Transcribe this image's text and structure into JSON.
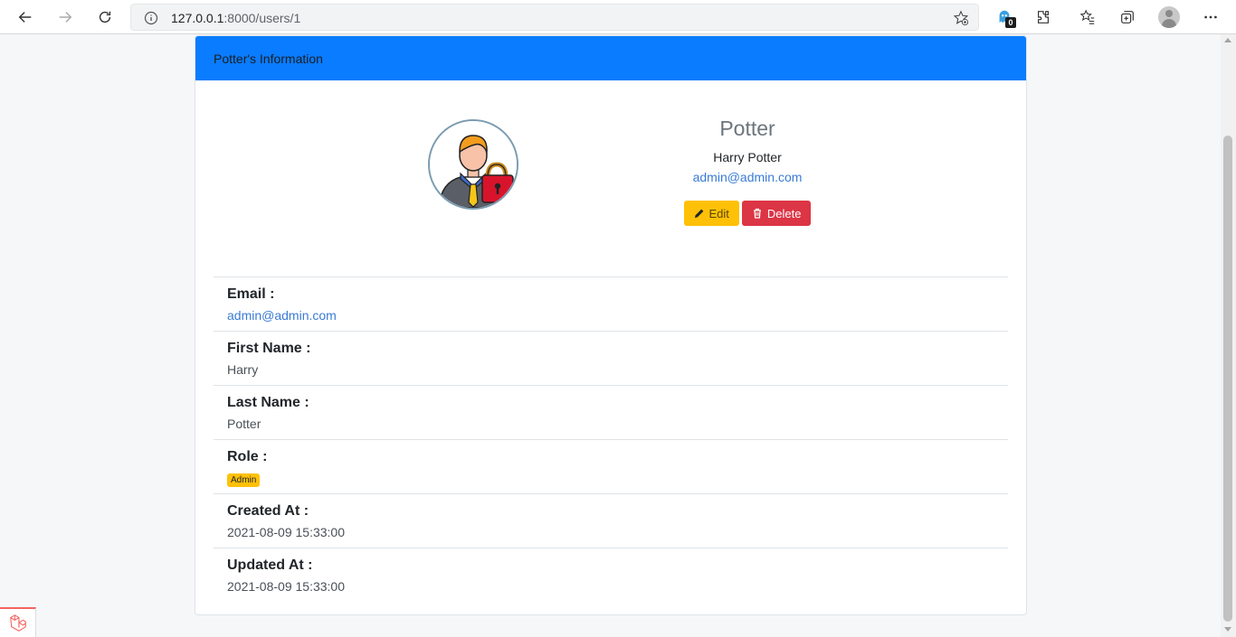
{
  "browser": {
    "url_host": "127.0.0.1",
    "url_rest": ":8000/users/1",
    "extension_badge": "0"
  },
  "card": {
    "header_title": "Potter's Information"
  },
  "profile": {
    "nickname": "Potter",
    "full_name": "Harry Potter",
    "email": "admin@admin.com",
    "edit_label": "Edit",
    "delete_label": "Delete"
  },
  "details": [
    {
      "label": "Email :",
      "value": "admin@admin.com"
    },
    {
      "label": "First Name :",
      "value": "Harry"
    },
    {
      "label": "Last Name :",
      "value": "Potter"
    },
    {
      "label": "Role :",
      "value": "Admin"
    },
    {
      "label": "Created At :",
      "value": "2021-08-09 15:33:00"
    },
    {
      "label": "Updated At :",
      "value": "2021-08-09 15:33:00"
    }
  ],
  "colors": {
    "header_bg": "#0a7cff",
    "edit_bg": "#ffc107",
    "delete_bg": "#dc3545",
    "link": "#3a7bd5"
  }
}
